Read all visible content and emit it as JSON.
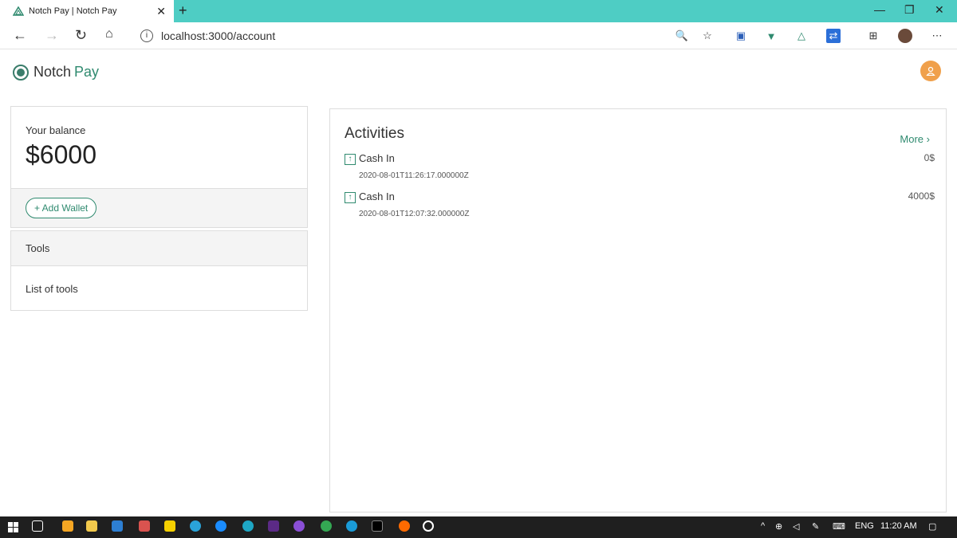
{
  "browser": {
    "tab_title": "Notch Pay | Notch Pay",
    "url": "localhost:3000/account"
  },
  "app": {
    "brand_name": "Notch",
    "brand_suffix": "Pay"
  },
  "balance": {
    "label": "Your balance",
    "value": "$6000"
  },
  "wallet": {
    "add_label": "+ Add Wallet"
  },
  "tools": {
    "header": "Tools",
    "body": "List of tools"
  },
  "activities": {
    "title": "Activities",
    "more_label": "More",
    "items": [
      {
        "type": "Cash In",
        "date": "2020-08-01T11:26:17.000000Z",
        "amount": "0$"
      },
      {
        "type": "Cash In",
        "date": "2020-08-01T12:07:32.000000Z",
        "amount": "4000$"
      }
    ]
  },
  "taskbar": {
    "language": "ENG",
    "time": "11:20 AM"
  },
  "colors": {
    "tab_bar": "#4ecdc4",
    "accent": "#2f8a6f",
    "avatar": "#f0a04b",
    "taskbar": "#1f1f1f"
  }
}
